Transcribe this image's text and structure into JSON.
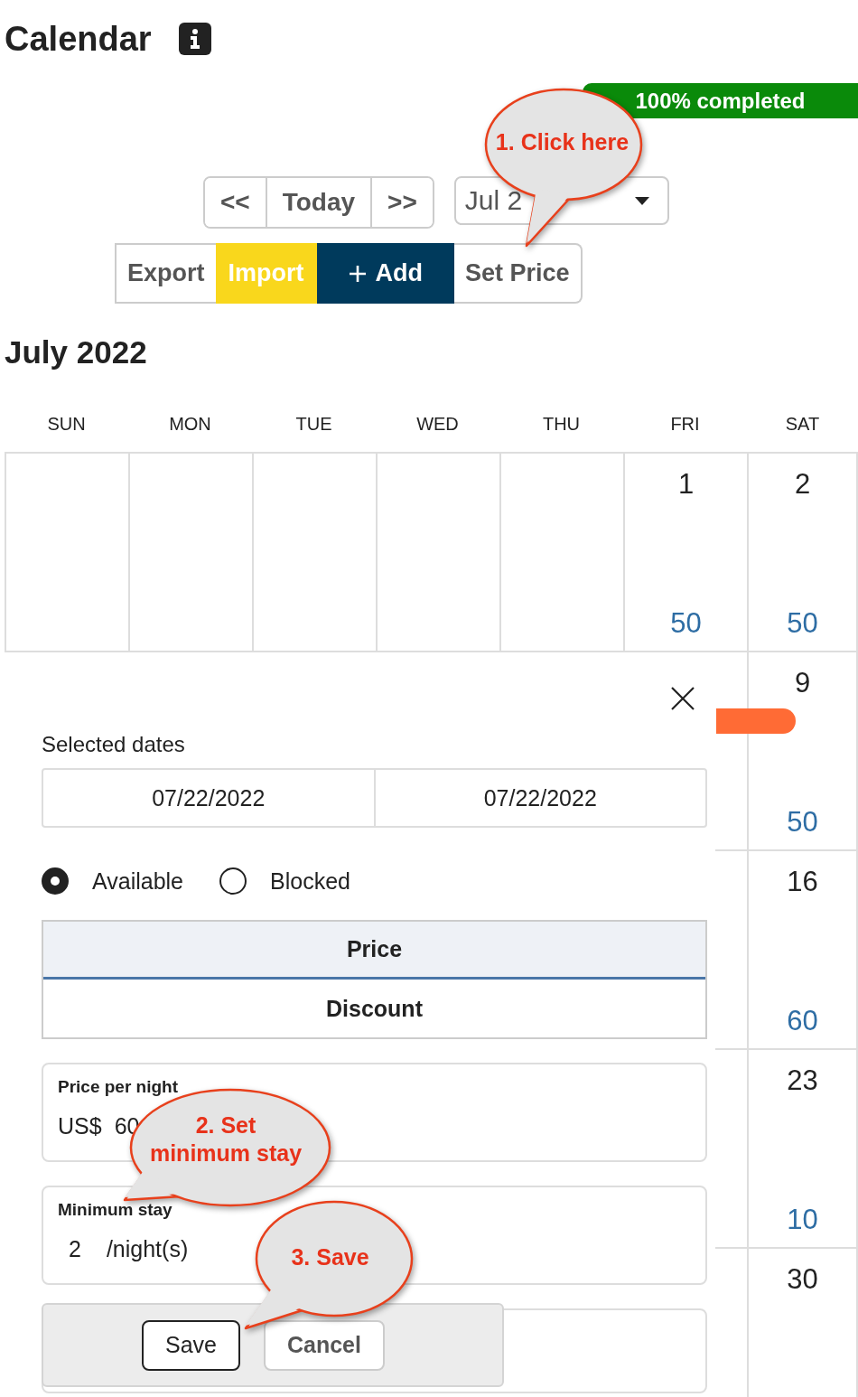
{
  "header": {
    "title": "Calendar"
  },
  "progress": {
    "label": "100% completed",
    "level": 1
  },
  "nav": {
    "buttons": [
      "<<",
      "Today",
      ">>"
    ],
    "month_select": {
      "value": "Jul 2"
    }
  },
  "actions": [
    {
      "label": "Export",
      "kind": "plain"
    },
    {
      "label": "Import",
      "kind": "yellow"
    },
    {
      "label": "Add",
      "kind": "add"
    },
    {
      "label": "Set Price",
      "kind": "plain"
    }
  ],
  "calendar": {
    "title": "July 2022",
    "weekdays": [
      "SUN",
      "MON",
      "TUE",
      "WED",
      "THU",
      "FRI",
      "SAT"
    ],
    "weeks": [
      {
        "cells": [
          {
            "kind": "blank"
          },
          {
            "kind": "blank"
          },
          {
            "kind": "blank"
          },
          {
            "kind": "blank"
          },
          {
            "kind": "blank"
          },
          {
            "kind": "day",
            "date": "1",
            "price": "50"
          },
          {
            "kind": "day",
            "date": "2",
            "price": "50"
          }
        ]
      },
      {
        "cells": [
          {
            "kind": "day",
            "date": "9",
            "price": "50",
            "event": true
          }
        ]
      },
      {
        "cells": [
          {
            "kind": "day",
            "date": "16",
            "price": "60"
          }
        ]
      },
      {
        "cells": [
          {
            "kind": "day",
            "date": "23",
            "price": "10"
          }
        ]
      },
      {
        "cells": [
          {
            "kind": "day",
            "date": "30"
          }
        ]
      }
    ]
  },
  "panel": {
    "dates_label": "Selected dates",
    "dates": [
      "07/22/2022",
      "07/22/2022"
    ],
    "status": [
      {
        "label": "Available",
        "selected": true
      },
      {
        "label": "Blocked",
        "selected": false
      }
    ],
    "tabs": [
      {
        "label": "Price",
        "selected": true
      },
      {
        "label": "Discount",
        "selected": false
      }
    ],
    "price_field": {
      "label": "Price per night",
      "currency": "US$",
      "value": "60"
    },
    "min_stay_field": {
      "label": "Minimum stay",
      "value": "2",
      "unit": "/night(s)"
    },
    "buttons": [
      {
        "label": "Save",
        "kind": "primary"
      },
      {
        "label": "Cancel",
        "kind": "secondary"
      }
    ]
  },
  "callouts": [
    {
      "text": "1. Click here"
    },
    {
      "text": "2. Set minimum stay"
    },
    {
      "text": "3. Save"
    }
  ]
}
